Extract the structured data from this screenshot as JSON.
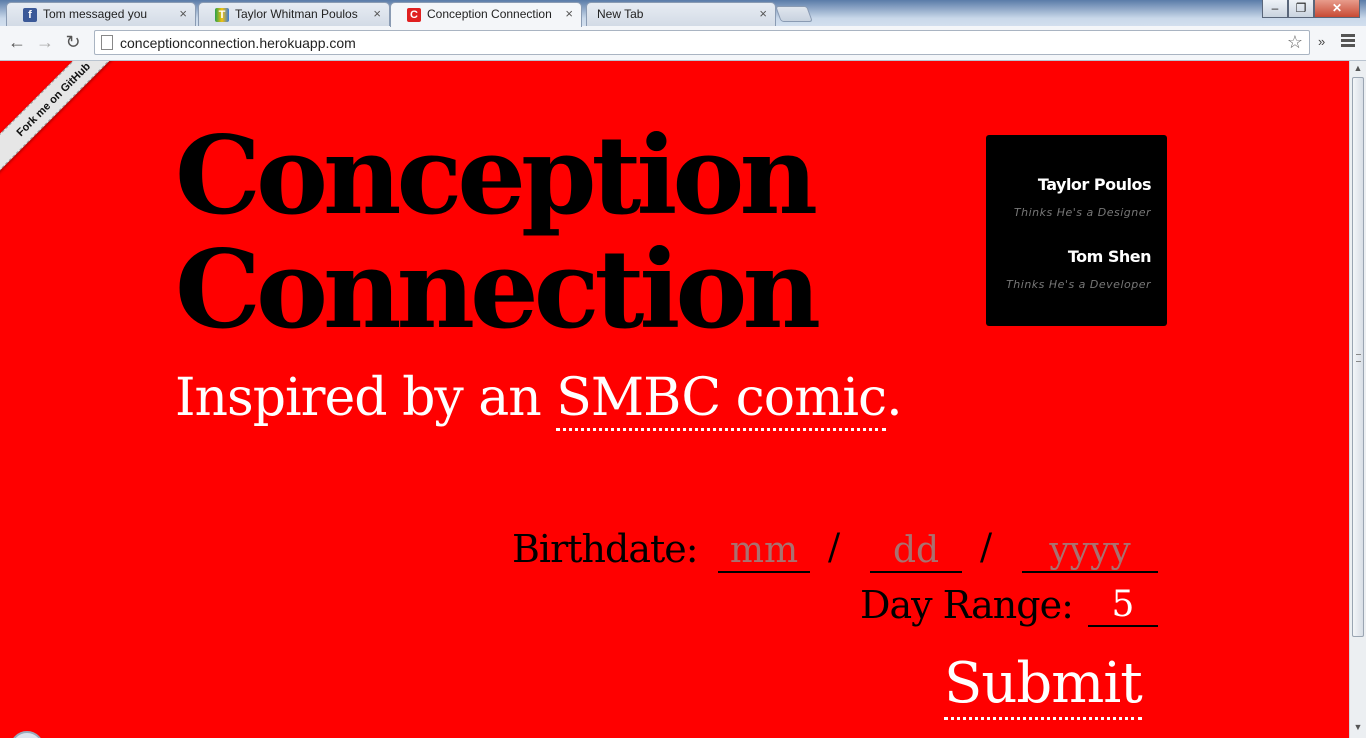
{
  "browser": {
    "tabs": [
      {
        "label": "Tom messaged you",
        "favicon": "f",
        "favicon_color": "#3b5998",
        "active": false
      },
      {
        "label": "Taylor Whitman Poulos",
        "favicon": "T",
        "favicon_color": "#2aa14a",
        "active": false
      },
      {
        "label": "Conception Connection",
        "favicon": "C",
        "favicon_color": "#e02020",
        "active": true
      },
      {
        "label": "New Tab",
        "favicon": "",
        "favicon_color": "",
        "active": false
      }
    ],
    "close_glyph": "×",
    "url": "conceptionconnection.herokuapp.com",
    "window_controls": {
      "minimize": "–",
      "maximize": "❐",
      "close": "✕"
    },
    "overflow_glyph": "»"
  },
  "page": {
    "ribbon": "Fork me on GitHub",
    "title_line1": "Conception",
    "title_line2": "Connection",
    "subtitle_prefix": "Inspired by an ",
    "subtitle_link": "SMBC comic",
    "subtitle_suffix": ".",
    "credits": [
      {
        "name": "Taylor Poulos",
        "role": "Thinks He's a Designer"
      },
      {
        "name": "Tom Shen",
        "role": "Thinks He's a Developer"
      }
    ],
    "form": {
      "birthdate_label": "Birthdate:",
      "month_placeholder": "mm",
      "day_placeholder": "dd",
      "year_placeholder": "yyyy",
      "separator": "/",
      "day_range_label": "Day Range:",
      "day_range_value": "5",
      "submit_label": "Submit"
    }
  },
  "colors": {
    "background": "#ff0000",
    "title": "#000000",
    "accent_text": "#ffffff",
    "credit_box": "#000000"
  }
}
